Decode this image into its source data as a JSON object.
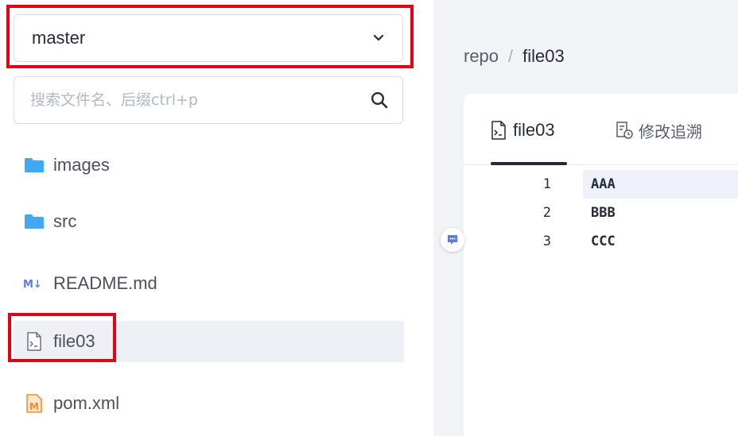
{
  "sidebar": {
    "branch_selector": {
      "value": "master"
    },
    "search": {
      "placeholder": "搜索文件名、后缀ctrl+p",
      "value": ""
    },
    "tree": [
      {
        "name": "images",
        "type": "folder",
        "icon": "folder-icon"
      },
      {
        "name": "src",
        "type": "folder",
        "icon": "folder-icon"
      },
      {
        "name": "README.md",
        "type": "markdown",
        "icon": "markdown-icon"
      },
      {
        "name": "file03",
        "type": "file",
        "icon": "terminal-file-icon",
        "selected": true
      },
      {
        "name": "pom.xml",
        "type": "maven",
        "icon": "maven-file-icon"
      }
    ]
  },
  "main": {
    "breadcrumb": {
      "root": "repo",
      "separator": "/",
      "current": "file03"
    },
    "tabs": [
      {
        "label": "file03",
        "icon": "terminal-file-icon",
        "active": true
      },
      {
        "label": "修改追溯",
        "icon": "blame-icon",
        "active": false
      }
    ],
    "code_lines": [
      {
        "number": "1",
        "text": "AAA"
      },
      {
        "number": "2",
        "text": "BBB"
      },
      {
        "number": "3",
        "text": "CCC"
      }
    ]
  },
  "colors": {
    "accent_red": "#e60012",
    "folder_blue": "#3fa9f5",
    "markdown_blue": "#5e7ce0",
    "maven_orange": "#f28c28",
    "content_bg": "#f2f3f6"
  }
}
